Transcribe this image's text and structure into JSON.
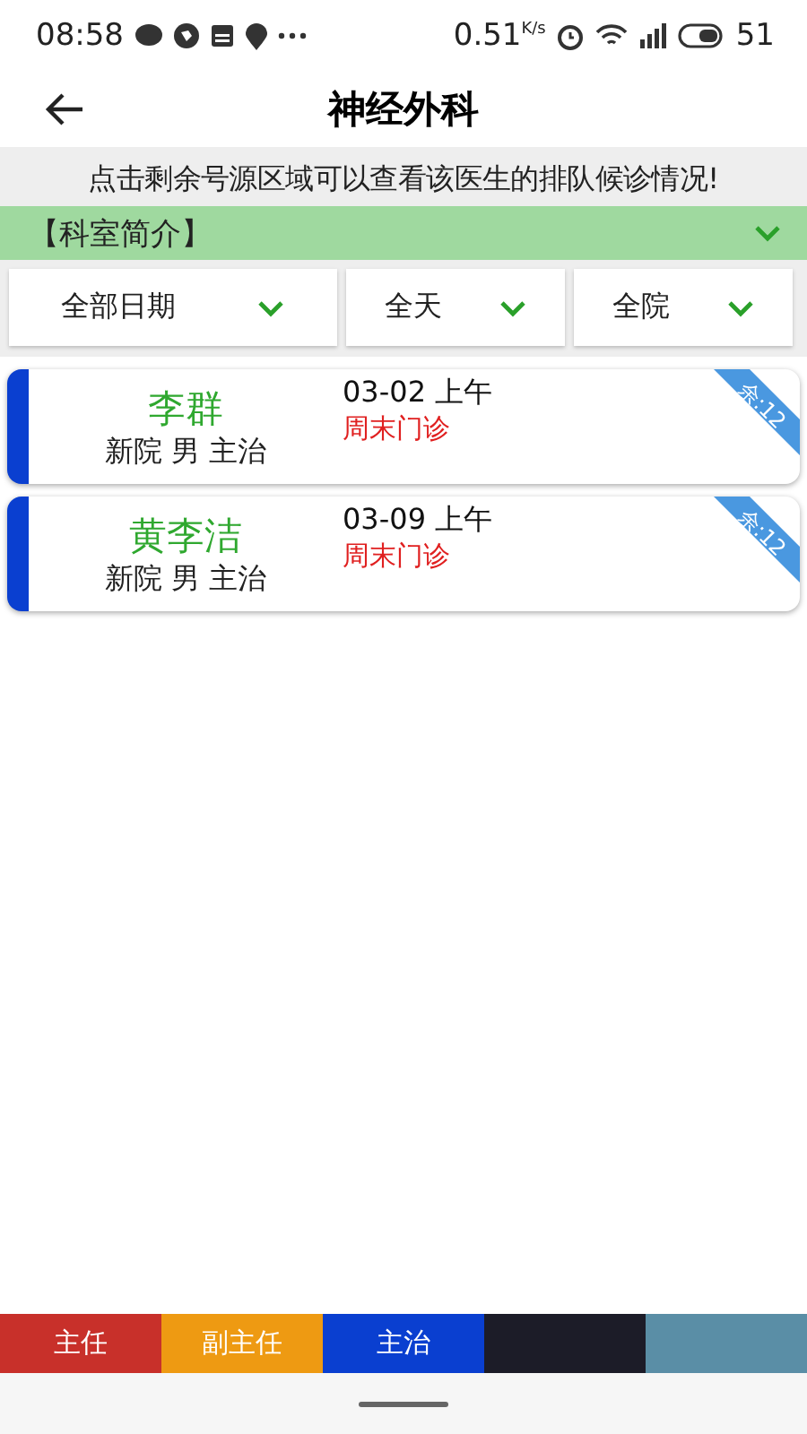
{
  "status_bar": {
    "time": "08:58",
    "speed": "0.51",
    "speed_unit": "K/s",
    "battery": "51"
  },
  "header": {
    "title": "神经外科"
  },
  "notice": "点击剩余号源区域可以查看该医生的排队候诊情况!",
  "intro": {
    "label": "【科室简介】",
    "expanded": false
  },
  "filters": [
    {
      "label": "全部日期"
    },
    {
      "label": "全天"
    },
    {
      "label": "全院"
    }
  ],
  "doctors": [
    {
      "name": "李群",
      "info": "新院 男 主治",
      "date": "03-02 上午",
      "clinic": "周末门诊",
      "remaining": "余:12",
      "color": "#0a3fd0"
    },
    {
      "name": "黄李洁",
      "info": "新院 男 主治",
      "date": "03-09 上午",
      "clinic": "周末门诊",
      "remaining": "余:12",
      "color": "#0a3fd0"
    }
  ],
  "legend": [
    {
      "label": "主任",
      "color": "#c8302a"
    },
    {
      "label": "副主任",
      "color": "#ee9a12"
    },
    {
      "label": "主治",
      "color": "#0a3fd0"
    },
    {
      "color": "#1c1c28"
    },
    {
      "color": "#5a8ea6"
    }
  ]
}
